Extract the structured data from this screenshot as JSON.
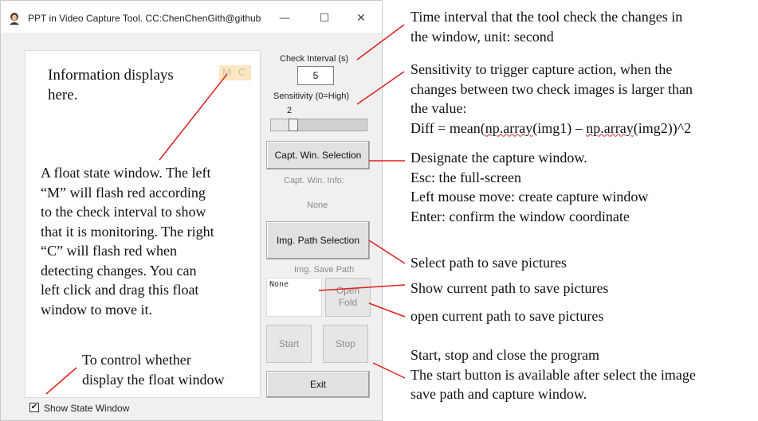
{
  "window": {
    "title": "PPT in Video Capture Tool. CC:ChenChenGith@github",
    "icon": "app-avatar-icon",
    "controls": {
      "minimize": "—",
      "maximize": "☐",
      "close": "✕"
    }
  },
  "info_panel": {
    "text": "Information displays here.",
    "float_window": {
      "m": "M",
      "c": "C"
    },
    "float_description": "A float state window. The left “M” will flash red according to the check interval to show that it is monitoring. The right “C” will flash red when detecting changes. You can left click and drag this float window to move it."
  },
  "show_state": {
    "label": "Show State Window",
    "checked": true,
    "check_glyph": "✔"
  },
  "check_interval": {
    "label": "Check Interval (s)",
    "value": "5"
  },
  "sensitivity": {
    "label": "Sensitivity (0=High)",
    "value": "2",
    "level": 0.2
  },
  "capture": {
    "button": "Capt. Win. Selection",
    "info_label": "Capt. Win. Info:",
    "info_value": "None"
  },
  "image_path": {
    "button": "Img. Path Selection",
    "label": "Img. Save Path",
    "value": "None",
    "open_line1": "Open",
    "open_line2": "Fold"
  },
  "actions": {
    "start": "Start",
    "stop": "Stop",
    "exit": "Exit"
  },
  "annotations": {
    "interval": [
      "Time interval that the tool check the changes in",
      "the window, unit: second"
    ],
    "sensitivity": [
      "Sensitivity to trigger capture action, when the",
      "changes between two check images is larger than",
      "the value:"
    ],
    "formula": {
      "a": "Diff = mean(",
      "np1": "np.array",
      "b": "(img1) – ",
      "np2": "np.array",
      "c": "(img2))^2"
    },
    "capture": [
      "Designate the capture window.",
      "Esc: the full-screen",
      "Left mouse move: create capture window",
      "Enter: confirm the window coordinate"
    ],
    "select_path": "Select path to save pictures",
    "show_path": "Show current path to save pictures",
    "open_path": "open current path to save pictures",
    "start_stop": [
      "Start, stop and close the program",
      "The start button is available after select the image",
      "save path and capture window."
    ],
    "float_toggle": [
      "To control whether",
      "display the float window"
    ],
    "float_desc_lines": [
      "A float state window. The left",
      "“M” will flash red according",
      "to the check interval to show",
      "that it is monitoring. The right",
      "“C” will flash red when",
      "detecting changes. You can",
      "left click and drag this float",
      "window to move it."
    ]
  },
  "colors": {
    "annotation_line": "#e0201c",
    "float_window_bg": "#fde7c2",
    "window_bg": "#f0f0f0"
  }
}
